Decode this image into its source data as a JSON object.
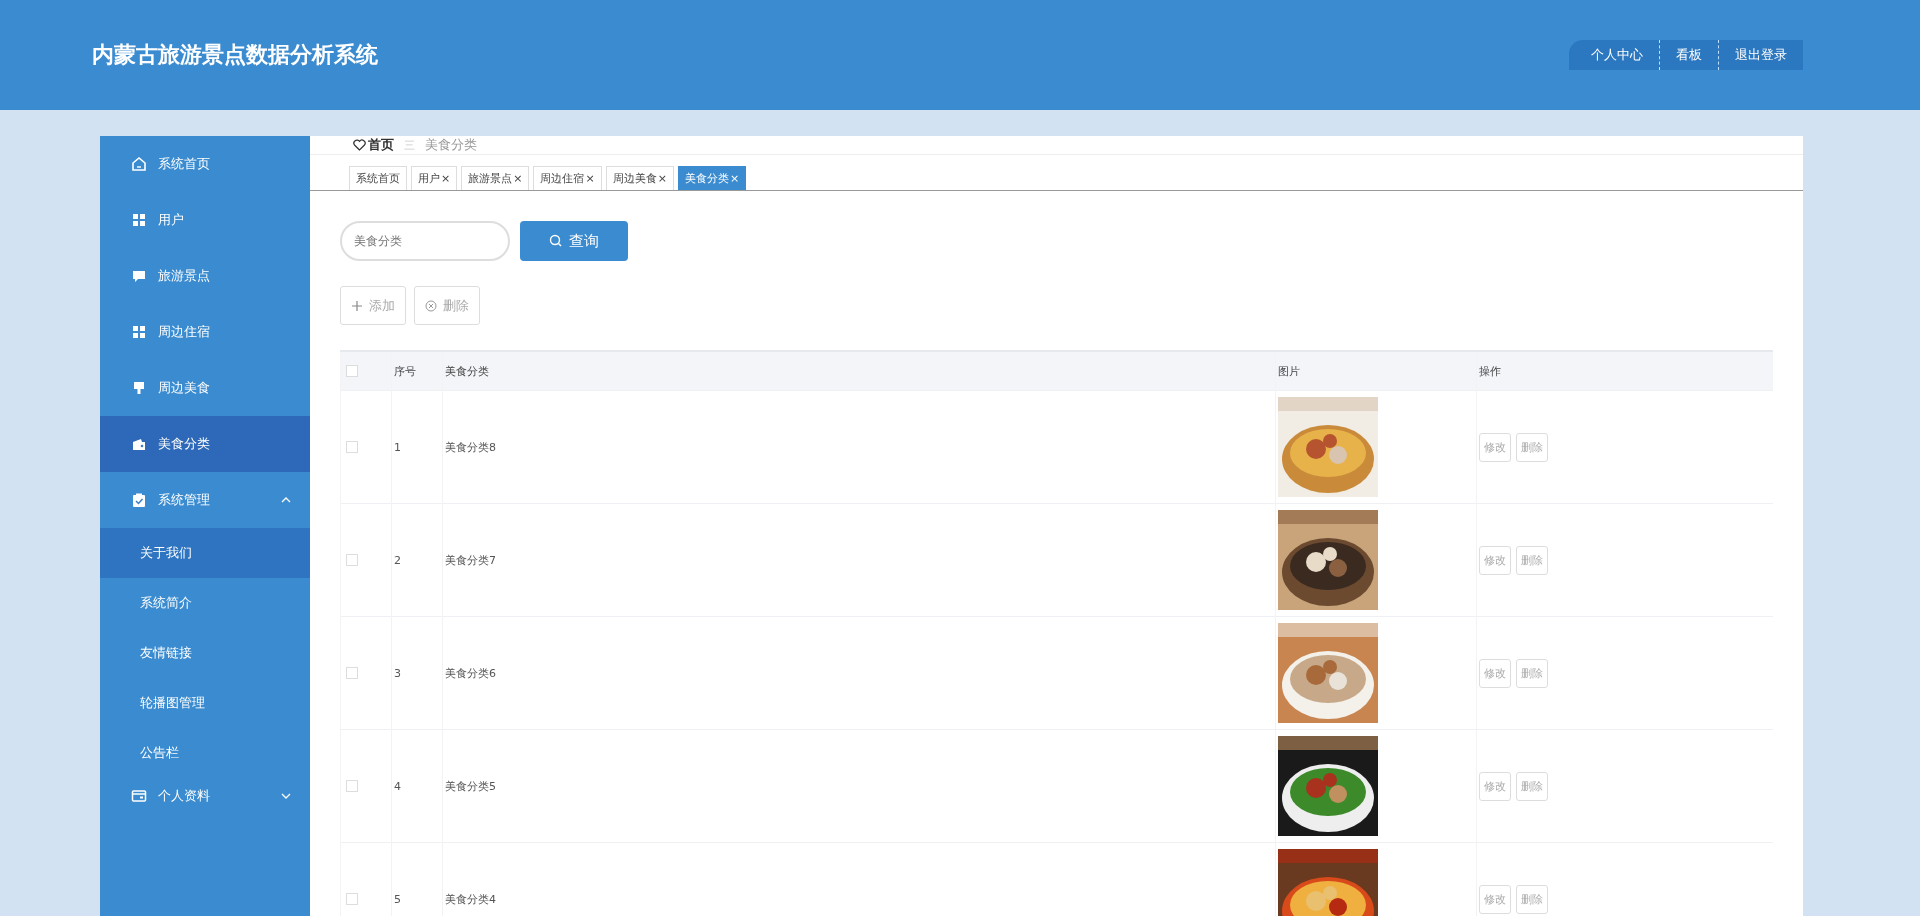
{
  "header": {
    "title": "内蒙古旅游景点数据分析系统",
    "nav": [
      {
        "label": "个人中心"
      },
      {
        "label": "看板"
      },
      {
        "label": "退出登录"
      }
    ]
  },
  "sidebar": {
    "items": [
      {
        "label": "系统首页",
        "selected": false
      },
      {
        "label": "用户",
        "selected": false
      },
      {
        "label": "旅游景点",
        "selected": false
      },
      {
        "label": "周边住宿",
        "selected": false
      },
      {
        "label": "周边美食",
        "selected": false
      },
      {
        "label": "美食分类",
        "selected": true
      },
      {
        "label": "系统管理",
        "selected": false,
        "expanded": true,
        "children": [
          {
            "label": "关于我们",
            "hovered": true
          },
          {
            "label": "系统简介",
            "hovered": false
          },
          {
            "label": "友情链接",
            "hovered": false
          },
          {
            "label": "轮播图管理",
            "hovered": false
          },
          {
            "label": "公告栏",
            "hovered": false
          }
        ]
      },
      {
        "label": "个人资料",
        "selected": false,
        "expanded": false
      }
    ]
  },
  "breadcrumb": {
    "home": "首页",
    "separator": "三",
    "current": "美食分类"
  },
  "tabs": [
    {
      "label": "系统首页",
      "selected": false
    },
    {
      "label": "用户",
      "close": "×",
      "selected": false
    },
    {
      "label": "旅游景点",
      "close": "×",
      "selected": false
    },
    {
      "label": "周边住宿",
      "close": "×",
      "selected": false
    },
    {
      "label": "周边美食",
      "close": "×",
      "selected": false
    },
    {
      "label": "美食分类",
      "close": "×",
      "selected": true
    }
  ],
  "search": {
    "placeholder": "美食分类",
    "button": "查询"
  },
  "actions": [
    {
      "label": "添加",
      "kind": "add"
    },
    {
      "label": "删除",
      "kind": "delete"
    }
  ],
  "table": {
    "all_checked": false,
    "columns": [
      "序号",
      "美食分类",
      "图片",
      "操作"
    ],
    "rows": [
      {
        "index": "1",
        "name": "美食分类8",
        "picture": {
          "kind": "picture"
        },
        "checked": false,
        "buttons": [
          "修改",
          "删除"
        ]
      },
      {
        "index": "2",
        "name": "美食分类7",
        "picture": {
          "kind": "picture"
        },
        "checked": false,
        "buttons": [
          "修改",
          "删除"
        ]
      },
      {
        "index": "3",
        "name": "美食分类6",
        "picture": {
          "kind": "picture"
        },
        "checked": false,
        "buttons": [
          "修改",
          "删除"
        ]
      },
      {
        "index": "4",
        "name": "美食分类5",
        "picture": {
          "kind": "picture"
        },
        "checked": false,
        "buttons": [
          "修改",
          "删除"
        ]
      },
      {
        "index": "5",
        "name": "美食分类4",
        "picture": {
          "kind": "picture"
        },
        "checked": false,
        "buttons": [
          "修改",
          "删除"
        ]
      }
    ]
  }
}
